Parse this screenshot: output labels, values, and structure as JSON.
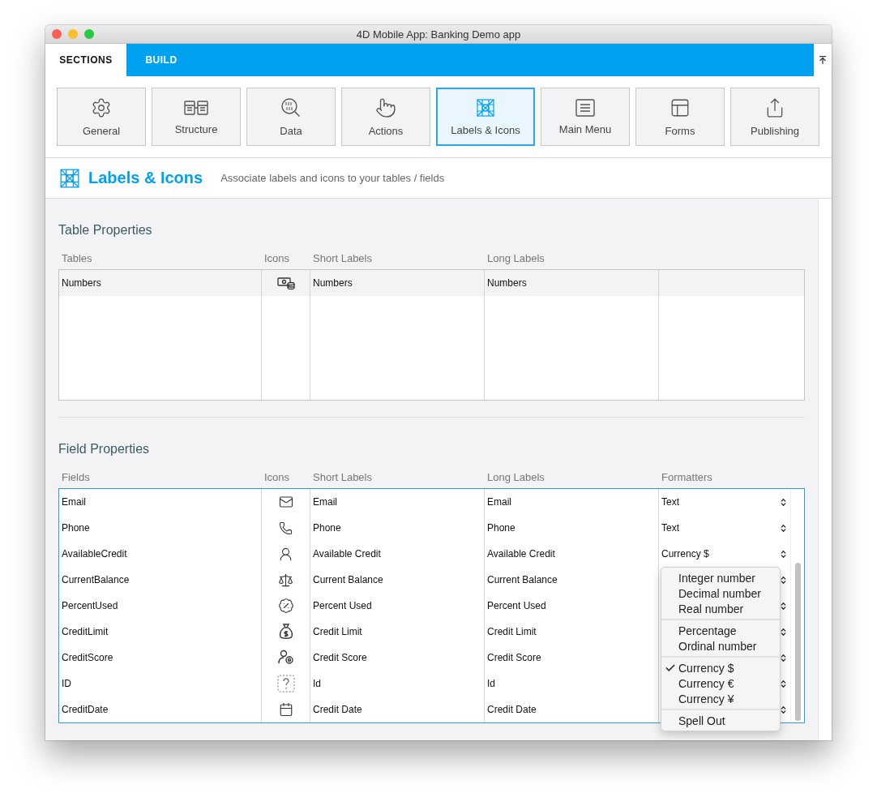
{
  "window": {
    "title": "4D Mobile App: Banking Demo app"
  },
  "top_tabs": [
    {
      "label": "SECTIONS",
      "selected": true
    },
    {
      "label": "BUILD",
      "selected": false
    }
  ],
  "sections": [
    {
      "label": "General",
      "selected": false
    },
    {
      "label": "Structure",
      "selected": false
    },
    {
      "label": "Data",
      "selected": false
    },
    {
      "label": "Actions",
      "selected": false
    },
    {
      "label": "Labels & Icons",
      "selected": true
    },
    {
      "label": "Main Menu",
      "selected": false
    },
    {
      "label": "Forms",
      "selected": false
    },
    {
      "label": "Publishing",
      "selected": false
    }
  ],
  "page_header": {
    "title": "Labels & Icons",
    "subtitle": "Associate labels and icons to your tables / fields"
  },
  "table_properties": {
    "title": "Table Properties",
    "columns": [
      "Tables",
      "Icons",
      "Short Labels",
      "Long Labels"
    ],
    "rows": [
      {
        "table": "Numbers",
        "short_label": "Numbers",
        "long_label": "Numbers",
        "selected": true
      }
    ]
  },
  "field_properties": {
    "title": "Field Properties",
    "columns": [
      "Fields",
      "Icons",
      "Short Labels",
      "Long Labels",
      "Formatters"
    ],
    "rows": [
      {
        "field": "Email",
        "short_label": "Email",
        "long_label": "Email",
        "formatter": "Text"
      },
      {
        "field": "Phone",
        "short_label": "Phone",
        "long_label": "Phone",
        "formatter": "Text"
      },
      {
        "field": "AvailableCredit",
        "short_label": "Available Credit",
        "long_label": "Available Credit",
        "formatter": "Currency $"
      },
      {
        "field": "CurrentBalance",
        "short_label": "Current Balance",
        "long_label": "Current Balance"
      },
      {
        "field": "PercentUsed",
        "short_label": "Percent Used",
        "long_label": "Percent Used"
      },
      {
        "field": "CreditLimit",
        "short_label": "Credit Limit",
        "long_label": "Credit Limit"
      },
      {
        "field": "CreditScore",
        "short_label": "Credit Score",
        "long_label": "Credit Score"
      },
      {
        "field": "ID",
        "short_label": "Id",
        "long_label": "Id"
      },
      {
        "field": "CreditDate",
        "short_label": "Credit Date",
        "long_label": "Credit Date"
      }
    ]
  },
  "formatter_menu": {
    "groups": [
      [
        {
          "label": "Integer number",
          "selected": false
        },
        {
          "label": "Decimal number",
          "selected": false
        },
        {
          "label": "Real number",
          "selected": false
        }
      ],
      [
        {
          "label": "Percentage",
          "selected": false
        },
        {
          "label": "Ordinal number",
          "selected": false
        }
      ],
      [
        {
          "label": "Currency $",
          "selected": true
        },
        {
          "label": "Currency €",
          "selected": false
        },
        {
          "label": "Currency ¥",
          "selected": false
        }
      ],
      [
        {
          "label": "Spell Out",
          "selected": false
        }
      ]
    ]
  }
}
